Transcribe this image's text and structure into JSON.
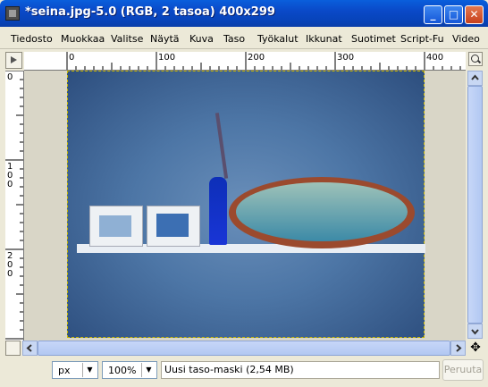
{
  "window": {
    "title": "*seina.jpg-5.0 (RGB, 2 tasoa) 400x299",
    "minimize_label": "_",
    "maximize_label": "□",
    "close_label": "✕"
  },
  "menu": [
    "Tiedosto",
    "Muokkaa",
    "Valitse",
    "Näytä",
    "Kuva",
    "Taso",
    "Työkalut",
    "Ikkunat",
    "Suotimet",
    "Script-Fu",
    "Video"
  ],
  "hruler": {
    "labels": [
      "0",
      "100",
      "200",
      "300",
      "400"
    ]
  },
  "vruler": {
    "labels": [
      "0",
      "1\n0\n0",
      "2\n0\n0"
    ]
  },
  "statusbar": {
    "unit": "px",
    "zoom": "100%",
    "message": "Uusi taso-maski (2,54 MB)",
    "cancel_label": "Peruuta"
  },
  "icons": {
    "app": "gimp-image-icon",
    "ruler_menu": "ruler-menu-arrow-icon",
    "zoom_toggle": "zoom-icon",
    "quick_mask": "quick-mask-icon",
    "navigate": "move-navigate-icon"
  },
  "colors": {
    "title_bar": "#0a49c8",
    "selection_outline": "#c8b800"
  }
}
